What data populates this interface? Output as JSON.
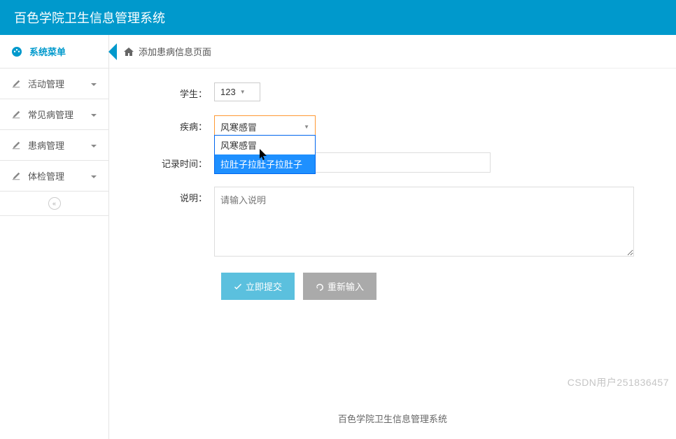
{
  "header": {
    "title": "百色学院卫生信息管理系统"
  },
  "sidebar": {
    "menu_title": "系统菜单",
    "items": [
      {
        "label": "活动管理"
      },
      {
        "label": "常见病管理"
      },
      {
        "label": "患病管理"
      },
      {
        "label": "体检管理"
      }
    ]
  },
  "breadcrumb": {
    "title": "添加患病信息页面"
  },
  "form": {
    "student": {
      "label": "学生：",
      "value": "123"
    },
    "disease": {
      "label": "疾病：",
      "selected": "风寒感冒",
      "options": [
        "风寒感冒",
        "拉肚子拉肚子拉肚子"
      ]
    },
    "record_time": {
      "label": "记录时间：",
      "value": ""
    },
    "description": {
      "label": "说明：",
      "placeholder": "请输入说明"
    },
    "submit_label": "立即提交",
    "reset_label": "重新输入"
  },
  "footer": {
    "text": "百色学院卫生信息管理系统"
  },
  "watermark": {
    "text": "CSDN用户251836457"
  }
}
